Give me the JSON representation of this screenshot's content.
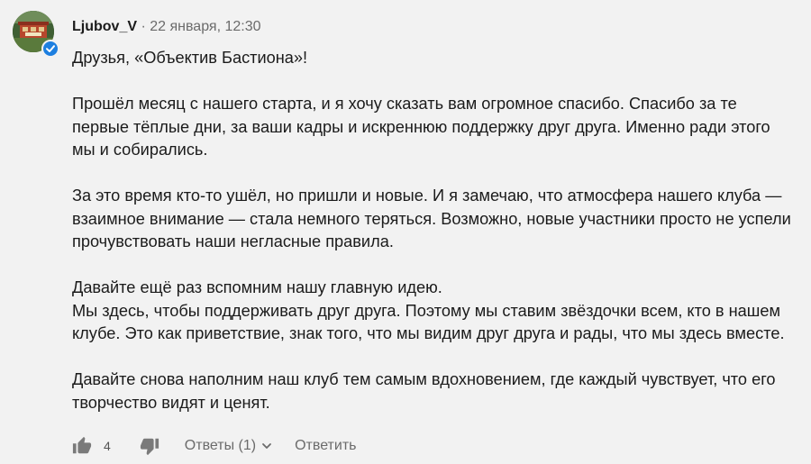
{
  "comment": {
    "author": "Ljubov_V",
    "separator": " · ",
    "timestamp": "22 января, 12:30",
    "paragraphs": [
      [
        "Друзья, «Объектив Бастиона»!"
      ],
      [
        "Прошёл месяц с нашего старта, и я хочу сказать вам огромное спасибо. Спасибо за те первые тёплые дни, за ваши кадры и искреннюю поддержку друг друга. Именно ради этого мы и собирались."
      ],
      [
        "За это время кто-то ушёл, но пришли и новые. И я замечаю, что атмосфера нашего клуба — взаимное внимание — стала немного теряться. Возможно, новые участники просто не успели прочувствовать наши негласные правила."
      ],
      [
        "Давайте ещё раз вспомним нашу главную идею.",
        "Мы здесь, чтобы поддерживать друг друга. Поэтому мы ставим звёздочки всем, кто в нашем клубе. Это как приветствие, знак того, что мы видим друг друга и рады, что мы здесь вместе."
      ],
      [
        "Давайте снова наполним наш клуб тем самым вдохновением, где каждый чувствует, что его творчество видят и ценят."
      ]
    ]
  },
  "actions": {
    "like_count": "4",
    "replies_label": "Ответы (1)",
    "reply_label": "Ответить"
  },
  "icons": {
    "like": "thumbs-up-icon",
    "dislike": "thumbs-down-icon",
    "chevron": "chevron-down-icon",
    "verified": "check-badge-icon"
  },
  "colors": {
    "background": "#f2f2f2",
    "text": "#1b1b1b",
    "muted": "#6b6b6b",
    "verified": "#1d7fe0"
  }
}
